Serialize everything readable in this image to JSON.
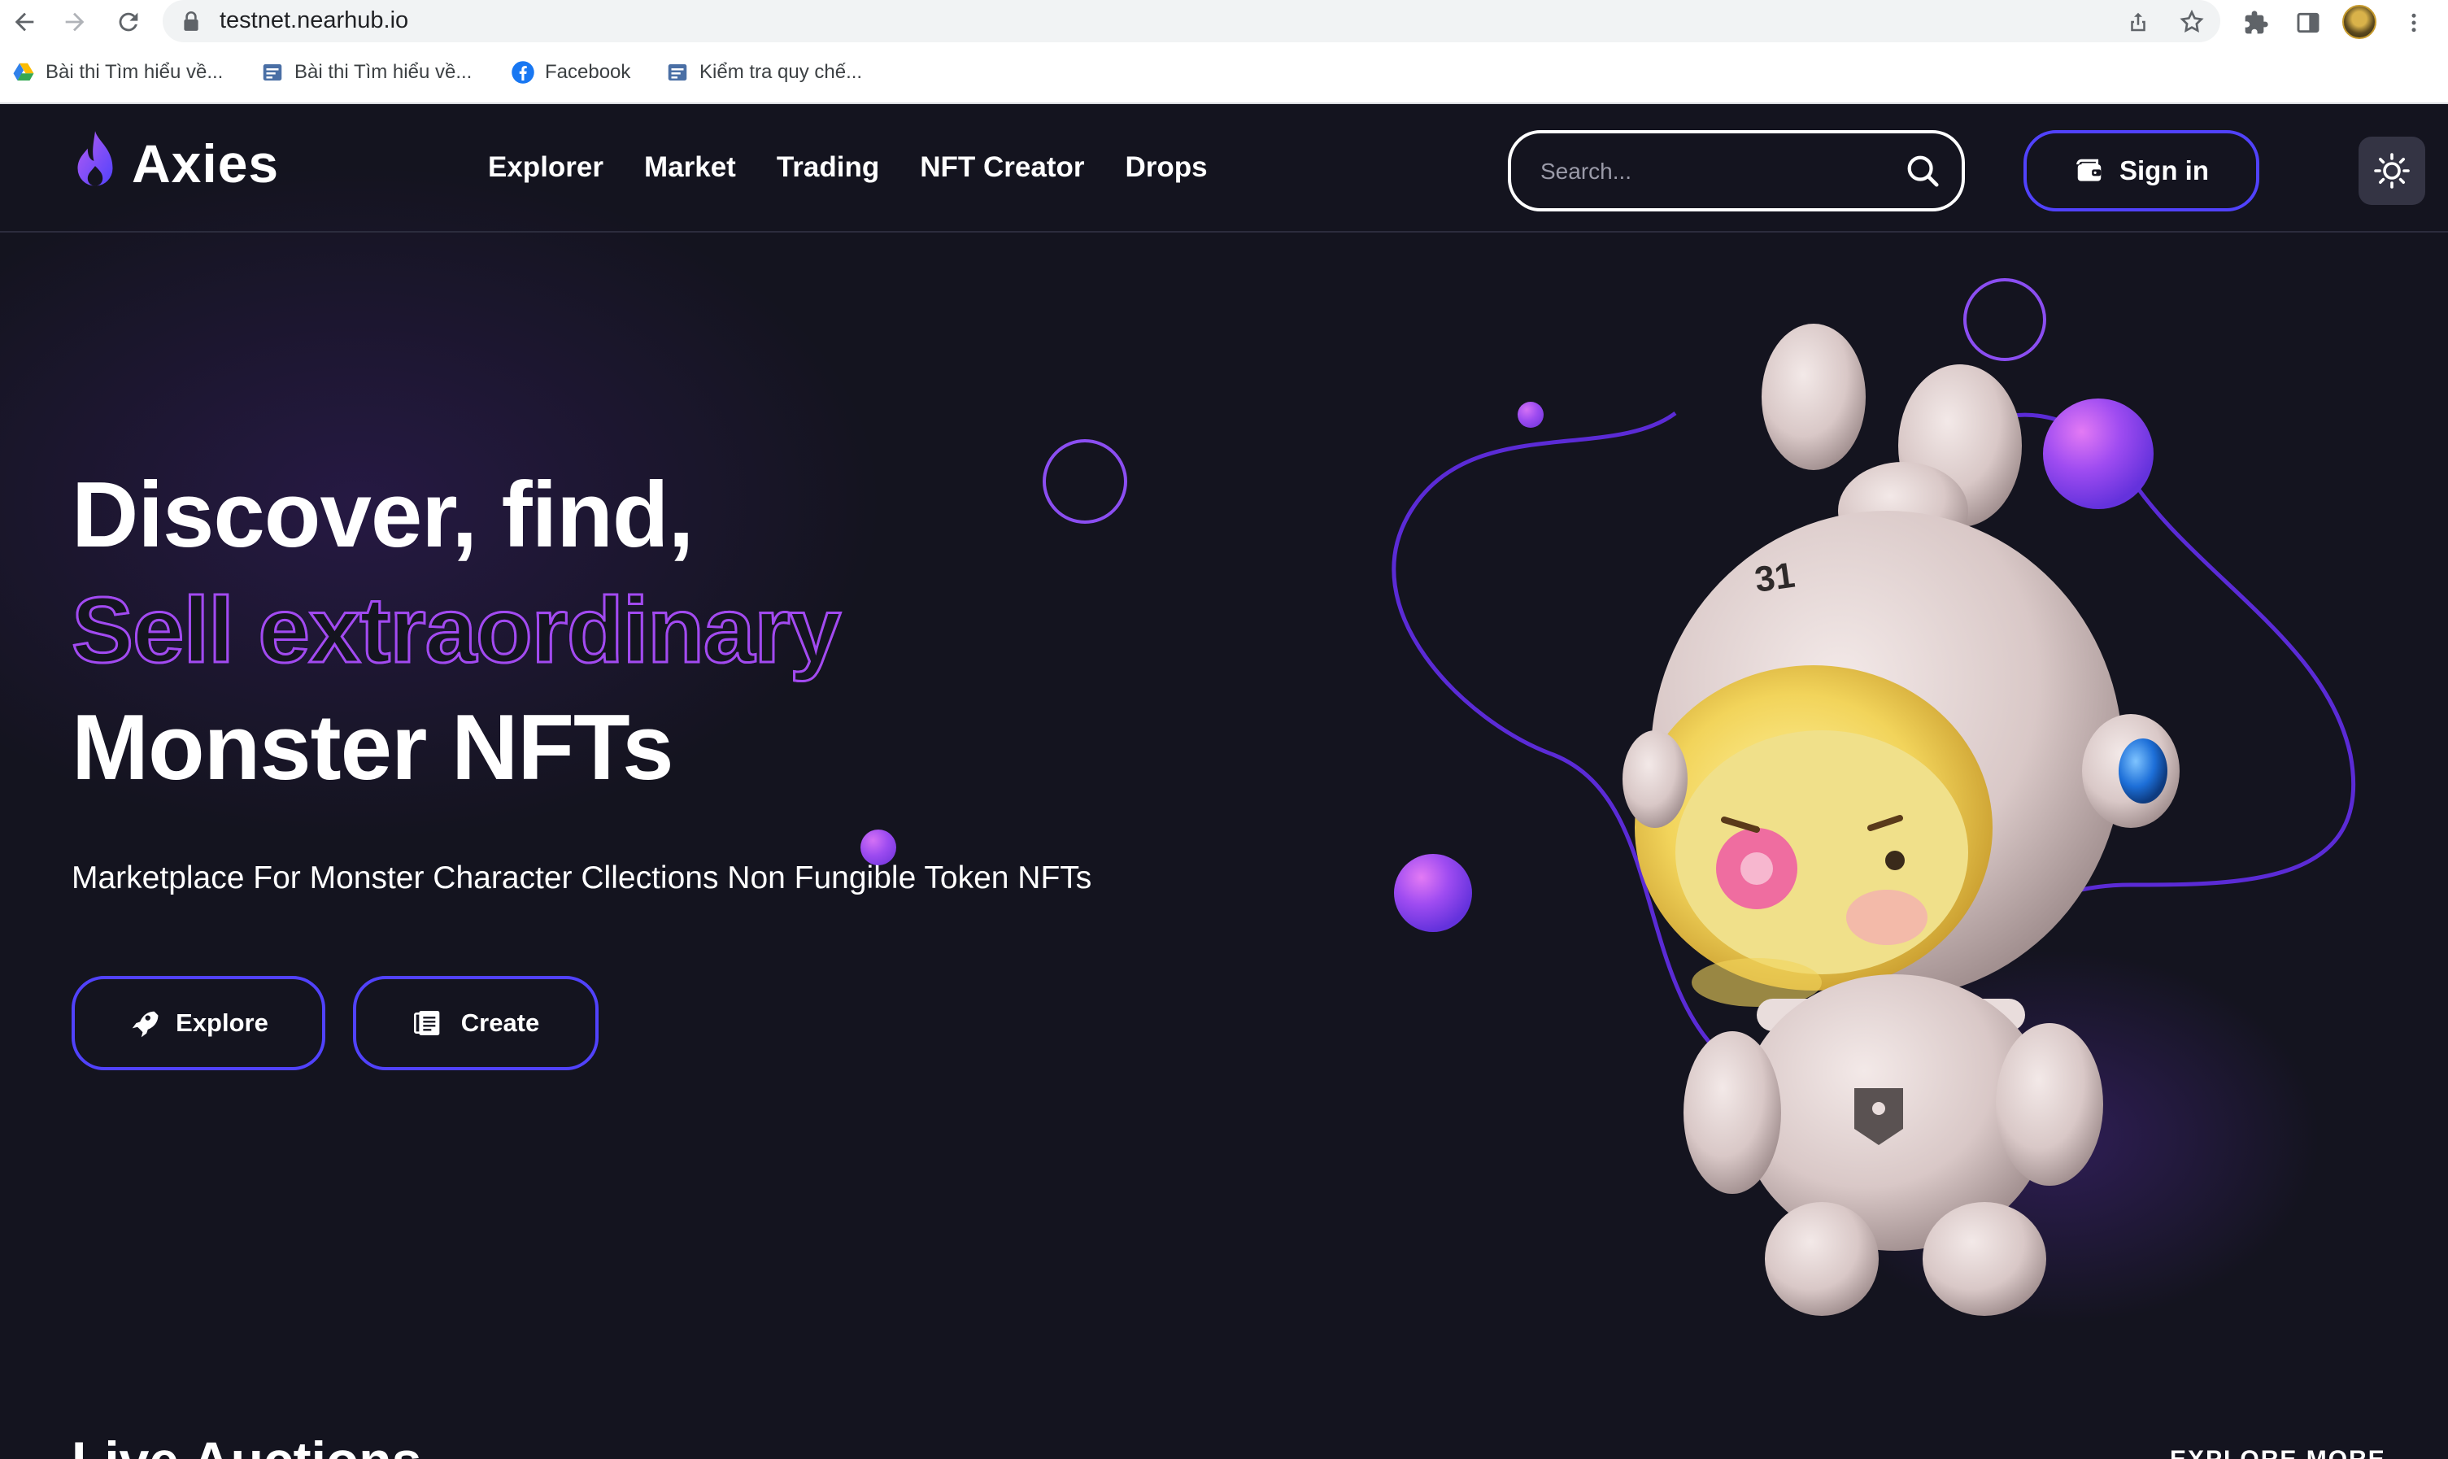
{
  "browser": {
    "url": "testnet.nearhub.io",
    "bookmarks": [
      {
        "label": "Bài thi Tìm hiểu về...",
        "icon": "google-drive-icon"
      },
      {
        "label": "Bài thi Tìm hiểu về...",
        "icon": "forms-icon"
      },
      {
        "label": "Facebook",
        "icon": "facebook-icon"
      },
      {
        "label": "Kiểm tra quy chế...",
        "icon": "forms-icon"
      }
    ]
  },
  "site": {
    "logo": "Axies",
    "nav": [
      "Explorer",
      "Market",
      "Trading",
      "NFT Creator",
      "Drops"
    ],
    "search_placeholder": "Search...",
    "signin_label": "Sign in",
    "colors": {
      "accent": "#5142fc",
      "background": "#14141f",
      "gradient_start": "#6b3df5",
      "gradient_end": "#c65ef0"
    }
  },
  "hero": {
    "line1": "Discover, find,",
    "line2": "Sell extraordinary",
    "line3": "Monster NFTs",
    "subtitle": "Marketplace For Monster Character Cllections Non Fungible Token NFTs",
    "explore_label": "Explore",
    "create_label": "Create",
    "figure_number": "31"
  },
  "section": {
    "title": "Live Auctions",
    "more": "EXPLORE MORE"
  }
}
